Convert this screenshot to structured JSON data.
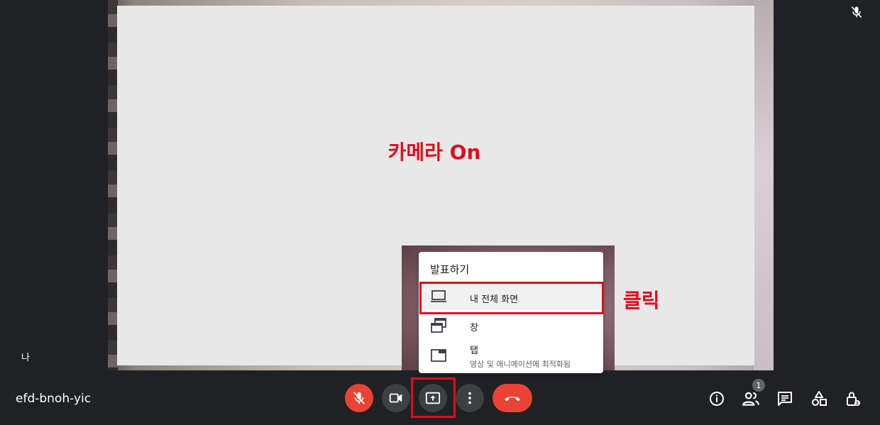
{
  "overlay": {
    "camera_label": "카메라 On",
    "click_label": "클릭"
  },
  "present_menu": {
    "title": "발표하기",
    "items": [
      {
        "label": "내 전체 화면",
        "icon": "laptop-icon"
      },
      {
        "label": "창",
        "icon": "window-icon"
      },
      {
        "label": "탭",
        "sublabel": "영상 및 애니메이션에 최적화됨",
        "icon": "tab-icon"
      }
    ]
  },
  "self_view": {
    "name": "나"
  },
  "meeting": {
    "code": "efd-bnoh-yic"
  },
  "controls": [
    {
      "name": "mic-off",
      "icon": "mic-off-icon"
    },
    {
      "name": "camera",
      "icon": "videocam-icon"
    },
    {
      "name": "present",
      "icon": "present-screen-icon"
    },
    {
      "name": "more",
      "icon": "more-vert-icon"
    },
    {
      "name": "hangup",
      "icon": "call-end-icon"
    }
  ],
  "right_toolbar": {
    "participants_count": "1",
    "icons": [
      "info-icon",
      "people-icon",
      "chat-icon",
      "activities-icon",
      "host-controls-icon"
    ]
  },
  "colors": {
    "background": "#202124",
    "accent_red": "#ea4335",
    "annotation_red": "#e00d1c",
    "button_gray": "#3c4043"
  }
}
